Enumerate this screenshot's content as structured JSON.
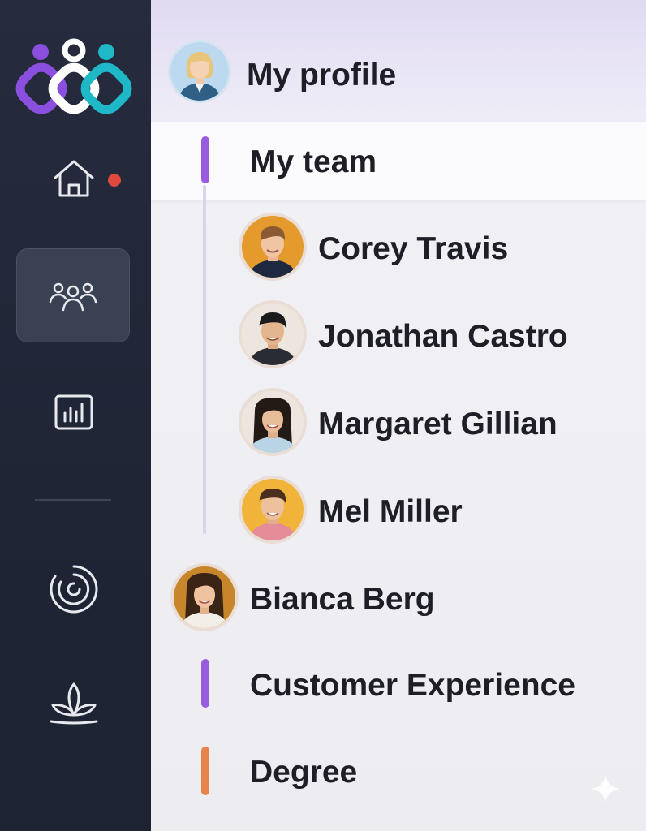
{
  "sidebar": {
    "icons": [
      "home-icon",
      "team-icon",
      "analytics-icon",
      "target-icon",
      "lotus-icon"
    ],
    "active": "team-icon",
    "notification": true
  },
  "profile": {
    "label": "My profile"
  },
  "team": {
    "label": "My team",
    "members": [
      {
        "name": "Corey Travis"
      },
      {
        "name": "Jonathan Castro"
      },
      {
        "name": "Margaret Gillian"
      },
      {
        "name": "Mel Miller"
      }
    ]
  },
  "manager": {
    "name": "Bianca Berg"
  },
  "groups": [
    {
      "label": "Customer Experience",
      "color": "#9b5bde"
    },
    {
      "label": "Degree",
      "color": "#e8834b"
    }
  ],
  "colors": {
    "accent": "#9b5bde",
    "notification": "#e0493c",
    "sidebar": "#262b3e"
  }
}
